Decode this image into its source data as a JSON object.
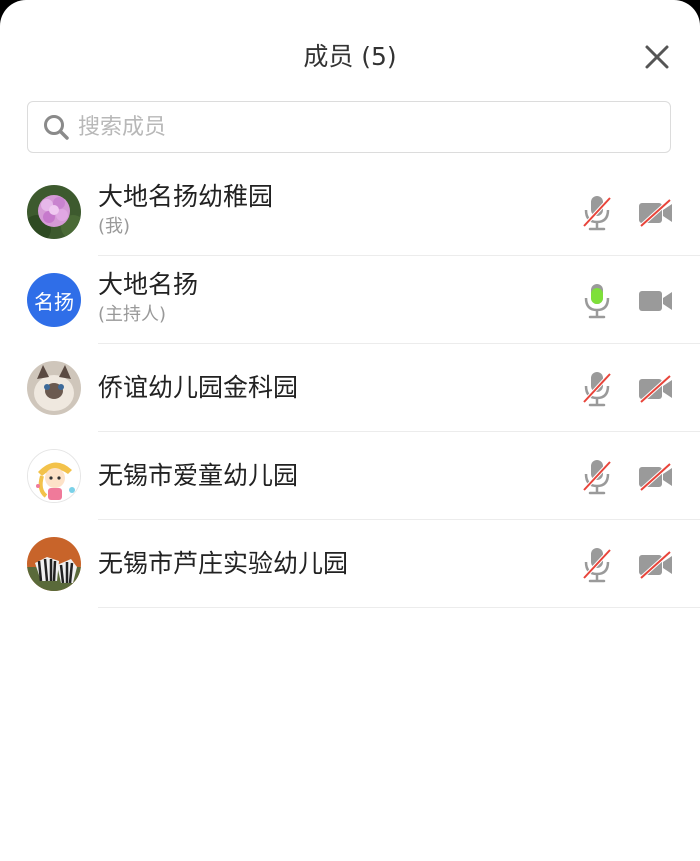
{
  "header": {
    "title": "成员 (5)"
  },
  "search": {
    "placeholder": "搜索成员",
    "value": ""
  },
  "members": [
    {
      "name": "大地名扬幼稚园",
      "subtitle": "(我)",
      "mic": "muted",
      "camera": "off"
    },
    {
      "name": "大地名扬",
      "subtitle": "(主持人)",
      "avatar_text": "名扬",
      "mic": "active",
      "camera": "on"
    },
    {
      "name": "侨谊幼儿园金科园",
      "subtitle": "",
      "mic": "muted",
      "camera": "off"
    },
    {
      "name": "无锡市爱童幼儿园",
      "subtitle": "",
      "mic": "muted",
      "camera": "off"
    },
    {
      "name": "无锡市芦庄实验幼儿园",
      "subtitle": "",
      "mic": "muted",
      "camera": "off"
    }
  ],
  "colors": {
    "accent": "#2f6ee8",
    "mic_active": "#7ee03a",
    "muted_slash": "#e8443a",
    "icon_gray": "#9a9a9a"
  }
}
